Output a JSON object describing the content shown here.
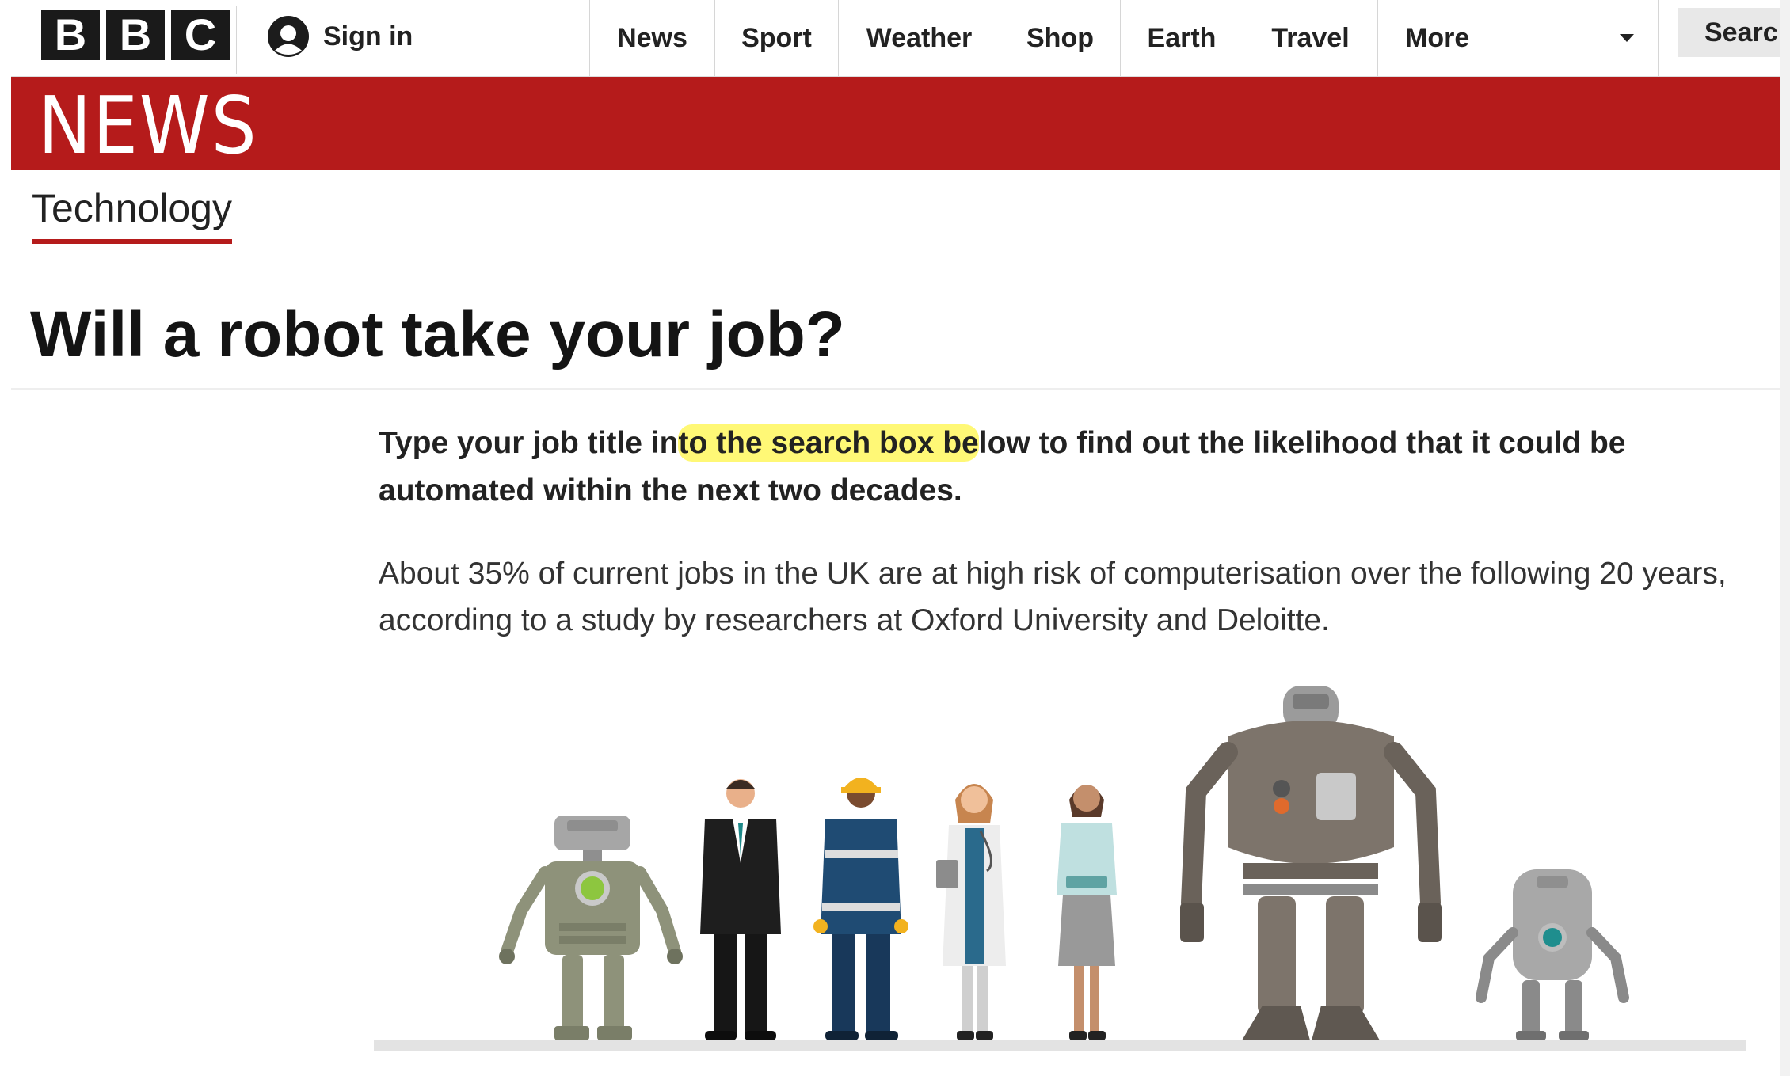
{
  "logo": {
    "letters": [
      "B",
      "B",
      "C"
    ]
  },
  "header": {
    "sign_in": "Sign in",
    "nav": [
      "News",
      "Sport",
      "Weather",
      "Shop",
      "Earth",
      "Travel",
      "More"
    ],
    "search_label": "Search"
  },
  "banner": {
    "title": "NEWS"
  },
  "section": {
    "label": "Technology"
  },
  "article": {
    "headline": "Will a robot take your job?",
    "intro_before": "Type your job title in",
    "intro_highlight": "to the search box be",
    "intro_after": "low to find out the likelihood that it could be automated within the next two decades.",
    "stat": "About 35% of current jobs in the UK are at high risk of computerisation over the following 20 years, according to a study by researchers at Oxford University and Deloitte."
  },
  "colors": {
    "brand_red": "#b51b1b",
    "highlight": "#fff75e",
    "logo_block": "#1a1a1a"
  },
  "illustration": {
    "figures": [
      "robot-left-icon",
      "businessman-icon",
      "construction-worker-icon",
      "doctor-icon",
      "office-worker-icon",
      "large-robot-icon",
      "small-robot-icon"
    ]
  }
}
